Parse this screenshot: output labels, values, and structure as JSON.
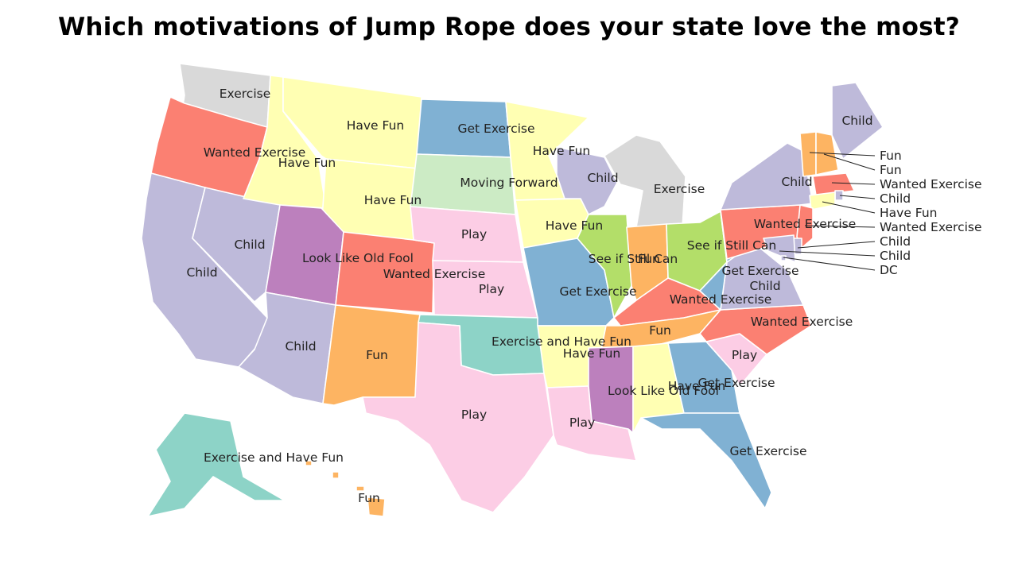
{
  "title": "Which motivations of Jump Rope does your state love the most?",
  "colors": {
    "Exercise": "#d9d9d9",
    "Have Fun": "#ffffb3",
    "Get Exercise": "#80b1d3",
    "Wanted Exercise": "#fb8072",
    "Moving Forward": "#ccebc5",
    "Child": "#bebada",
    "Play": "#fccde5",
    "Look Like Old Fool": "#bc80bd",
    "See if Still Can": "#b3de69",
    "Fun": "#fdb462",
    "Exercise and Have Fun": "#8dd3c7",
    "DC": "#bebada"
  },
  "states": [
    {
      "code": "WA",
      "value": "Exercise"
    },
    {
      "code": "OR",
      "value": "Wanted Exercise"
    },
    {
      "code": "CA",
      "value": "Child"
    },
    {
      "code": "NV",
      "value": "Child"
    },
    {
      "code": "ID",
      "value": "Have Fun"
    },
    {
      "code": "MT",
      "value": "Have Fun"
    },
    {
      "code": "WY",
      "value": "Have Fun"
    },
    {
      "code": "UT",
      "value": "Look Like Old Fool"
    },
    {
      "code": "CO",
      "value": "Wanted Exercise"
    },
    {
      "code": "AZ",
      "value": "Child"
    },
    {
      "code": "NM",
      "value": "Fun"
    },
    {
      "code": "ND",
      "value": "Get Exercise"
    },
    {
      "code": "SD",
      "value": "Moving Forward"
    },
    {
      "code": "NE",
      "value": "Play"
    },
    {
      "code": "KS",
      "value": "Play"
    },
    {
      "code": "OK",
      "value": "Exercise and Have Fun"
    },
    {
      "code": "TX",
      "value": "Play"
    },
    {
      "code": "MN",
      "value": "Have Fun"
    },
    {
      "code": "IA",
      "value": "Have Fun"
    },
    {
      "code": "MO",
      "value": "Get Exercise"
    },
    {
      "code": "AR",
      "value": "Have Fun"
    },
    {
      "code": "LA",
      "value": "Play"
    },
    {
      "code": "WI",
      "value": "Child"
    },
    {
      "code": "IL",
      "value": "See if Still Can"
    },
    {
      "code": "MI",
      "value": "Exercise"
    },
    {
      "code": "IN",
      "value": "Fun"
    },
    {
      "code": "OH",
      "value": "See if Still Can"
    },
    {
      "code": "KY",
      "value": "Wanted Exercise"
    },
    {
      "code": "TN",
      "value": "Fun"
    },
    {
      "code": "MS",
      "value": "Look Like Old Fool"
    },
    {
      "code": "AL",
      "value": "Have Fun"
    },
    {
      "code": "GA",
      "value": "Get Exercise"
    },
    {
      "code": "FL",
      "value": "Get Exercise"
    },
    {
      "code": "SC",
      "value": "Play"
    },
    {
      "code": "NC",
      "value": "Wanted Exercise"
    },
    {
      "code": "VA",
      "value": "Child"
    },
    {
      "code": "WV",
      "value": "Get Exercise"
    },
    {
      "code": "PA",
      "value": "Wanted Exercise"
    },
    {
      "code": "NY",
      "value": "Child"
    },
    {
      "code": "ME",
      "value": "Child"
    },
    {
      "code": "VT",
      "value": "Fun"
    },
    {
      "code": "NH",
      "value": "Fun"
    },
    {
      "code": "MA",
      "value": "Wanted Exercise"
    },
    {
      "code": "RI",
      "value": "Child"
    },
    {
      "code": "CT",
      "value": "Have Fun"
    },
    {
      "code": "NJ",
      "value": "Wanted Exercise"
    },
    {
      "code": "DE",
      "value": "Child"
    },
    {
      "code": "MD",
      "value": "Child"
    },
    {
      "code": "DC",
      "value": "DC"
    },
    {
      "code": "AK",
      "value": "Exercise and Have Fun"
    },
    {
      "code": "HI",
      "value": "Fun"
    }
  ]
}
